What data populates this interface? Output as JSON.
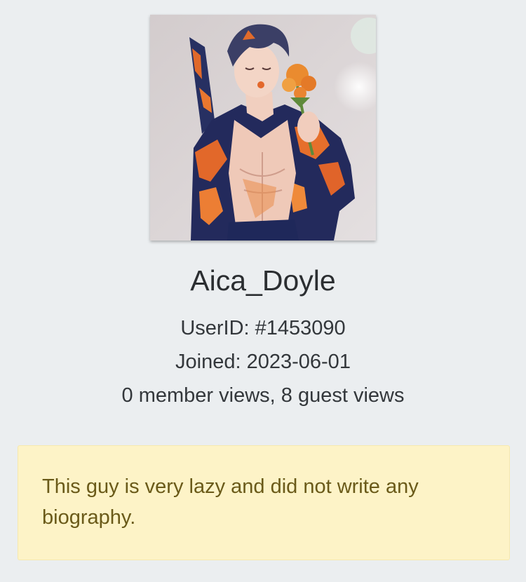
{
  "profile": {
    "avatar_icon": "user-avatar-illustration",
    "username": "Aica_Doyle",
    "user_id_text": "UserID: #1453090",
    "joined_text": "Joined: 2023-06-01",
    "views_text": "0 member views, 8 guest views",
    "bio_text": "This guy is very lazy and did not write any biography."
  },
  "colors": {
    "page_background": "#ebeef0",
    "bio_background": "#fdf3c7",
    "bio_text": "#6a5a19",
    "text_primary": "#2b2e31"
  }
}
